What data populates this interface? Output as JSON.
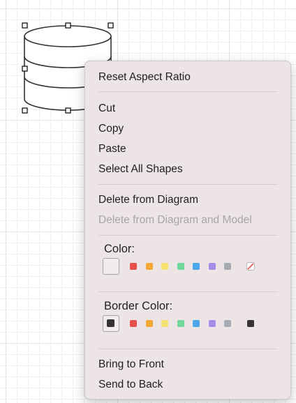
{
  "menu": {
    "reset_aspect_ratio": "Reset Aspect Ratio",
    "cut": "Cut",
    "copy": "Copy",
    "paste": "Paste",
    "select_all_shapes": "Select All Shapes",
    "delete_from_diagram": "Delete from Diagram",
    "delete_from_diagram_and_model": "Delete from Diagram and Model",
    "bring_to_front": "Bring to Front",
    "send_to_back": "Send to Back"
  },
  "color_section": {
    "label": "Color:",
    "selected": "none",
    "swatches": [
      "#e8504b",
      "#f4a935",
      "#f6e270",
      "#6fd89a",
      "#4aa8ea",
      "#a98bea",
      "#a4abb2"
    ],
    "clear_icon": "no-color-icon"
  },
  "border_section": {
    "label": "Border Color:",
    "selected": "#333333",
    "swatches": [
      "#e8504b",
      "#f4a935",
      "#f6e270",
      "#6fd89a",
      "#4aa8ea",
      "#a98bea",
      "#a4abb2",
      "#333333"
    ]
  },
  "shape": {
    "type": "database-cylinder",
    "selected": true
  },
  "colors": {
    "menu_background": "#ece4e5",
    "text": "#1f1f1f",
    "disabled_text": "#aaa4a5",
    "shape_stroke": "#333333"
  }
}
